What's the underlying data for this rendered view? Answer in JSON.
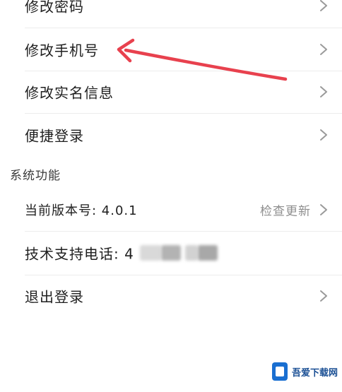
{
  "account_settings": {
    "items": [
      {
        "label": "修改密码"
      },
      {
        "label": "修改手机号"
      },
      {
        "label": "修改实名信息"
      },
      {
        "label": "便捷登录"
      }
    ]
  },
  "system_section": {
    "title": "系统功能",
    "version": {
      "label": "当前版本号: 4.0.1",
      "action": "检查更新"
    },
    "support_phone": {
      "label": "技术支持电话: 4"
    },
    "logout": {
      "label": "退出登录"
    }
  },
  "annotation": {
    "arrow_color": "#e8414e",
    "target": "修改手机号"
  },
  "watermark": {
    "text": "吾爱下载网"
  },
  "colors": {
    "background": "#ffffff",
    "text": "#1f1f1f",
    "muted": "#8e8e8e",
    "chevron": "#9a9a9a",
    "arrow": "#e8414e"
  }
}
